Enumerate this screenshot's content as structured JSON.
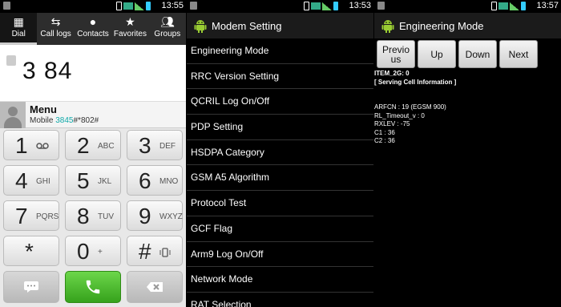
{
  "dialer": {
    "time": "13:55",
    "tabs": [
      {
        "label": "Dial"
      },
      {
        "label": "Call logs"
      },
      {
        "label": "Contacts"
      },
      {
        "label": "Favorites"
      },
      {
        "label": "Groups"
      }
    ],
    "number": "3 84",
    "contact": {
      "name": "Menu",
      "label_prefix": "Mobile",
      "number_match": "3845",
      "number_rest": "#*802#"
    },
    "keys": [
      {
        "digit": "1",
        "letters": ""
      },
      {
        "digit": "2",
        "letters": "ABC"
      },
      {
        "digit": "3",
        "letters": "DEF"
      },
      {
        "digit": "4",
        "letters": "GHI"
      },
      {
        "digit": "5",
        "letters": "JKL"
      },
      {
        "digit": "6",
        "letters": "MNO"
      },
      {
        "digit": "7",
        "letters": "PQRS"
      },
      {
        "digit": "8",
        "letters": "TUV"
      },
      {
        "digit": "9",
        "letters": "WXYZ"
      },
      {
        "digit": "*",
        "letters": ""
      },
      {
        "digit": "0",
        "letters": "+"
      },
      {
        "digit": "#",
        "letters": ""
      }
    ],
    "colors": {
      "call_green": "#4cc030",
      "match_cyan": "#1aa"
    }
  },
  "modem": {
    "time": "13:53",
    "title": "Modem Setting",
    "items": [
      {
        "label": "Engineering Mode"
      },
      {
        "label": "RRC Version Setting"
      },
      {
        "label": "QCRIL Log On/Off"
      },
      {
        "label": "PDP Setting"
      },
      {
        "label": "HSDPA Category"
      },
      {
        "label": "GSM A5 Algorithm"
      },
      {
        "label": "Protocol Test"
      },
      {
        "label": "GCF Flag"
      },
      {
        "label": "Arm9 Log On/Off"
      },
      {
        "label": "Network Mode"
      },
      {
        "label": "RAT Selection"
      }
    ]
  },
  "engineering": {
    "time": "13:57",
    "title": "Engineering Mode",
    "buttons": [
      {
        "label": "Previo\nus"
      },
      {
        "label": "Up"
      },
      {
        "label": "Down"
      },
      {
        "label": "Next"
      }
    ],
    "lines": [
      {
        "text": "ITEM_2G: 0",
        "bold": true
      },
      {
        "text": "[ Serving Cell Information ]",
        "bold": true
      },
      {
        "text": "",
        "bold": false
      },
      {
        "text": "",
        "bold": false
      },
      {
        "text": "ARFCN : 19 (EGSM 900)",
        "bold": false
      },
      {
        "text": "RL_Timeout_v : 0",
        "bold": false
      },
      {
        "text": "RXLEV : -75",
        "bold": false
      },
      {
        "text": "C1 : 36",
        "bold": false
      },
      {
        "text": "C2 : 36",
        "bold": false
      }
    ]
  }
}
